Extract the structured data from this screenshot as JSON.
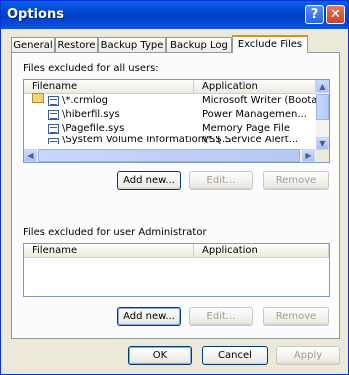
{
  "window": {
    "title": "Options",
    "help_glyph": "?",
    "close_glyph": "✕"
  },
  "tabs": [
    {
      "label": "General"
    },
    {
      "label": "Restore"
    },
    {
      "label": "Backup Type"
    },
    {
      "label": "Backup Log"
    },
    {
      "label": "Exclude Files",
      "active": true
    }
  ],
  "all_users": {
    "label": "Files excluded for all users:",
    "columns": {
      "filename": "Filename",
      "application": "Application"
    },
    "rows": [
      {
        "filename": "\\*.crmlog",
        "application": "Microsoft Writer (Boota..."
      },
      {
        "filename": "\\hiberfil.sys",
        "application": "Power Managemen..."
      },
      {
        "filename": "\\Pagefile.sys",
        "application": "Memory Page File"
      },
      {
        "filename": "\\System Volume Information\\*.{...",
        "application": "VSS Service Alert..."
      }
    ],
    "add_label": "Add new...",
    "edit_label": "Edit...",
    "remove_label": "Remove"
  },
  "admin_user": {
    "label": "Files excluded for user Administrator",
    "columns": {
      "filename": "Filename",
      "application": "Application"
    },
    "add_label": "Add new...",
    "edit_label": "Edit...",
    "remove_label": "Remove"
  },
  "footer": {
    "ok_label": "OK",
    "cancel_label": "Cancel",
    "apply_label": "Apply"
  },
  "colors": {
    "title_bar": "#0054e3",
    "dialog_bg": "#ece9d8",
    "active_tab_accent": "#e68b2c"
  }
}
